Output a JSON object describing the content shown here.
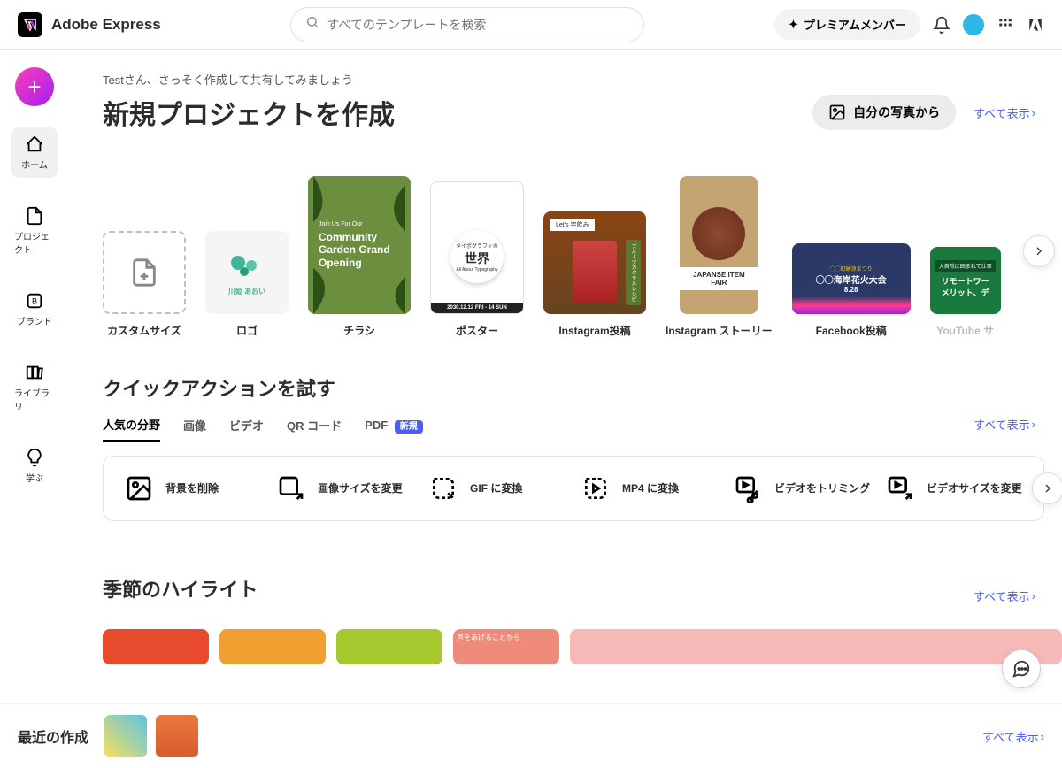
{
  "header": {
    "brand": "Adobe Express",
    "search_placeholder": "すべてのテンプレートを検索",
    "premium_label": "プレミアムメンバー"
  },
  "sidebar": {
    "items": [
      {
        "label": "ホーム"
      },
      {
        "label": "プロジェクト"
      },
      {
        "label": "ブランド"
      },
      {
        "label": "ライブラリ"
      },
      {
        "label": "学ぶ"
      }
    ]
  },
  "hero": {
    "greeting": "Testさん、さっそく作成して共有してみましょう",
    "title": "新規プロジェクトを作成",
    "from_photos": "自分の写真から",
    "view_all": "すべて表示"
  },
  "templates": [
    {
      "label": "カスタムサイズ"
    },
    {
      "label": "ロゴ"
    },
    {
      "label": "チラシ",
      "overlay_pre": "Join Us For Our",
      "overlay": "Community Garden Grand Opening"
    },
    {
      "label": "ポスター",
      "overlay_top": "タイポグラフィの",
      "overlay": "世界",
      "overlay_sub": "All About Typography",
      "overlay_date": "2030.12.12 FRI - 14 SUN"
    },
    {
      "label": "Instagram投稿",
      "overlay_top": "Let's 宅飲み",
      "overlay_side": "フルーツカクテルレシピ"
    },
    {
      "label": "Instagram ストーリー",
      "overlay": "JAPANSE ITEM FAIR"
    },
    {
      "label": "Facebook投稿",
      "overlay_pre": "◯◯町納涼まつり",
      "overlay": "◯◯海岸花火大会",
      "overlay_date": "8.28"
    },
    {
      "label": "YouTube サ",
      "overlay_pre": "大自然に囲まれて仕事",
      "overlay": "リモートワー\nメリット、デ"
    }
  ],
  "quick": {
    "title": "クイックアクションを試す",
    "view_all": "すべて表示",
    "tabs": [
      {
        "label": "人気の分野",
        "active": true
      },
      {
        "label": "画像"
      },
      {
        "label": "ビデオ"
      },
      {
        "label": "QR コード"
      },
      {
        "label": "PDF",
        "badge": "新規"
      }
    ],
    "actions": [
      {
        "label": "背景を削除"
      },
      {
        "label": "画像サイズを変更"
      },
      {
        "label": "GIF に変換"
      },
      {
        "label": "MP4 に変換"
      },
      {
        "label": "ビデオをトリミング"
      },
      {
        "label": "ビデオサイズを変更"
      }
    ]
  },
  "seasonal": {
    "title": "季節のハイライト",
    "view_all": "すべて表示",
    "card_text": "声をあげることから"
  },
  "recent": {
    "title": "最近の作成",
    "view_all": "すべて表示"
  }
}
